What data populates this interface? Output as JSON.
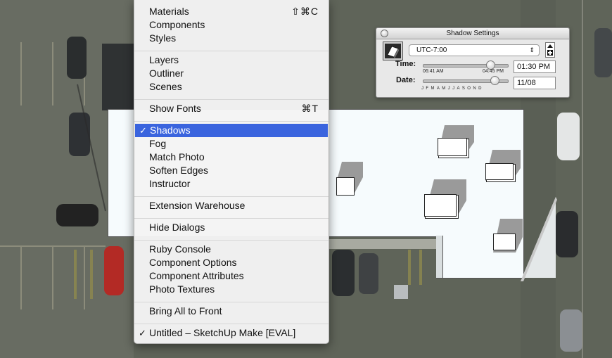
{
  "menu": {
    "groups": [
      [
        {
          "label": "Materials",
          "shortcut": "⇧⌘C"
        },
        {
          "label": "Components",
          "shortcut": ""
        },
        {
          "label": "Styles",
          "shortcut": ""
        }
      ],
      [
        {
          "label": "Layers",
          "shortcut": ""
        },
        {
          "label": "Outliner",
          "shortcut": ""
        },
        {
          "label": "Scenes",
          "shortcut": ""
        }
      ],
      [
        {
          "label": "Show Fonts",
          "shortcut": "⌘T"
        }
      ],
      [
        {
          "label": "Shadows",
          "shortcut": "",
          "checked": true,
          "highlighted": true
        },
        {
          "label": "Fog",
          "shortcut": ""
        },
        {
          "label": "Match Photo",
          "shortcut": ""
        },
        {
          "label": "Soften Edges",
          "shortcut": ""
        },
        {
          "label": "Instructor",
          "shortcut": ""
        }
      ],
      [
        {
          "label": "Extension Warehouse",
          "shortcut": ""
        }
      ],
      [
        {
          "label": "Hide Dialogs",
          "shortcut": ""
        }
      ],
      [
        {
          "label": "Ruby Console",
          "shortcut": ""
        },
        {
          "label": "Component Options",
          "shortcut": ""
        },
        {
          "label": "Component Attributes",
          "shortcut": ""
        },
        {
          "label": "Photo Textures",
          "shortcut": ""
        }
      ],
      [
        {
          "label": "Bring All to Front",
          "shortcut": ""
        }
      ],
      [
        {
          "label": "Untitled – SketchUp Make [EVAL]",
          "shortcut": "",
          "checked": true
        }
      ]
    ],
    "checkmark": "✓",
    "highlight_color": "#3a64de"
  },
  "palette": {
    "title": "Shadow Settings",
    "timezone": "UTC-7:00",
    "time_label": "Time:",
    "date_label": "Date:",
    "sunrise": "06:41 AM",
    "sunset": "04:45 PM",
    "time_value": "01:30 PM",
    "date_value": "11/08",
    "months": "JFMAMJJASOND",
    "time_slider_fraction": 0.8,
    "date_slider_fraction": 0.85,
    "icons": {
      "close": "close-icon",
      "toggle": "shadow-toggle-icon",
      "select_arrow": "updown-arrow-icon",
      "expand": "expand-icon"
    }
  },
  "colors": {
    "model_plane": "#f6fbfd",
    "shadow_gray": "#9a9a9a",
    "aerial_base": "#5f6459"
  }
}
